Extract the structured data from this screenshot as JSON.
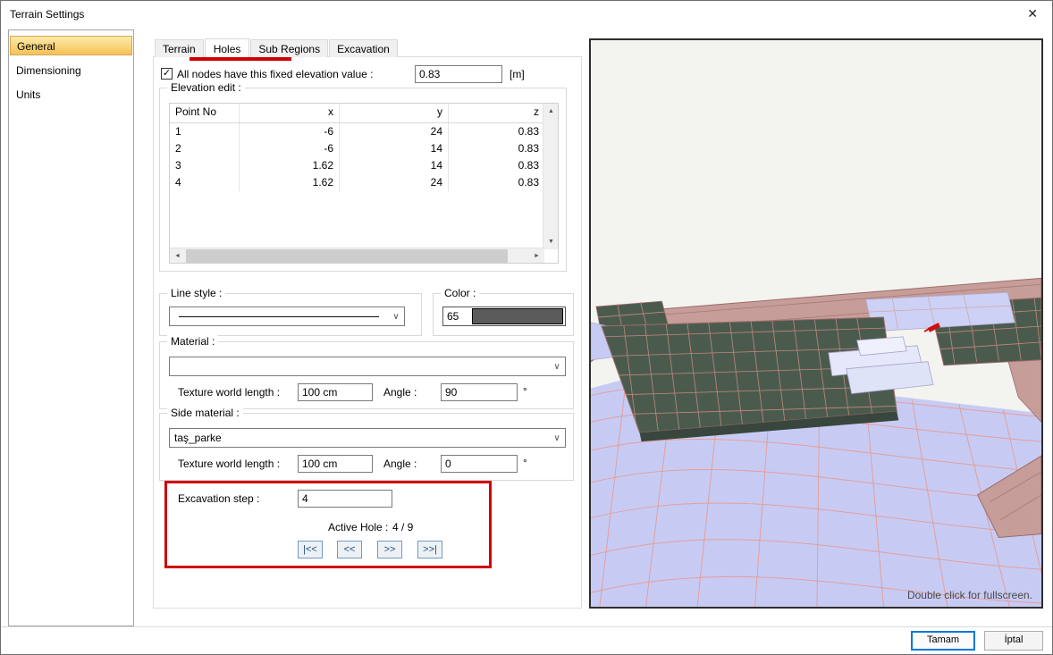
{
  "icons": {
    "close": "✕",
    "check": "✓",
    "chevron_down": "∨",
    "scroll_up": "▲",
    "scroll_down": "▼",
    "scroll_left": "◄",
    "scroll_right": "►",
    "degree": "°"
  },
  "window": {
    "title": "Terrain Settings"
  },
  "sidebar": {
    "items": [
      {
        "label": "General",
        "selected": true
      },
      {
        "label": "Dimensioning",
        "selected": false
      },
      {
        "label": "Units",
        "selected": false
      }
    ]
  },
  "tabs": {
    "items": [
      {
        "label": "Terrain",
        "selected": false
      },
      {
        "label": "Holes",
        "selected": true
      },
      {
        "label": "Sub Regions",
        "selected": false
      },
      {
        "label": "Excavation",
        "selected": false
      }
    ]
  },
  "fixed_elevation": {
    "label": "All nodes have this fixed elevation value :",
    "checked": true,
    "value": "0.83",
    "unit": "[m]"
  },
  "elevation_edit": {
    "title": "Elevation edit :",
    "columns": [
      "Point No",
      "x",
      "y",
      "z"
    ],
    "rows": [
      [
        "1",
        "-6",
        "24",
        "0.83"
      ],
      [
        "2",
        "-6",
        "14",
        "0.83"
      ],
      [
        "3",
        "1.62",
        "14",
        "0.83"
      ],
      [
        "4",
        "1.62",
        "24",
        "0.83"
      ]
    ]
  },
  "line_style": {
    "title": "Line style :"
  },
  "color": {
    "title": "Color :",
    "value": "65",
    "swatch_color": "#5b5b5b"
  },
  "material": {
    "title": "Material :",
    "value": "",
    "texture_label": "Texture world length :",
    "texture_value": "100 cm",
    "angle_label": "Angle :",
    "angle_value": "90"
  },
  "side_material": {
    "title": "Side material :",
    "value": "taş_parke",
    "texture_label": "Texture world length :",
    "texture_value": "100 cm",
    "angle_label": "Angle :",
    "angle_value": "0"
  },
  "excavation_nav": {
    "step_label": "Excavation step :",
    "step_value": "4",
    "active_label": "Active Hole :",
    "active_value": "4 / 9",
    "first": "|<<",
    "prev": "<<",
    "next": ">>",
    "last": ">>|"
  },
  "preview": {
    "hint": "Double click for fullscreen."
  },
  "footer": {
    "ok": "Tamam",
    "cancel": "İptal"
  },
  "annotation_color": "#cf0000"
}
